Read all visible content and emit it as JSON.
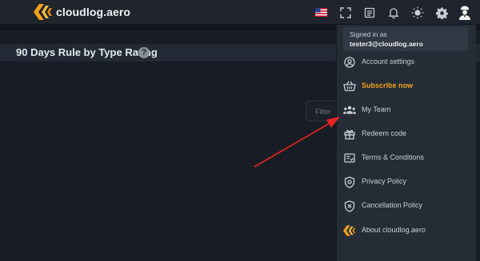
{
  "app": {
    "brand_name": "cloudlog.aero",
    "brand_color": "#f0a31d"
  },
  "topbar": {
    "icons": [
      "us-flag-icon",
      "expand-icon",
      "logbook-icon",
      "bell-icon",
      "brightness-icon",
      "gear-icon",
      "user-avatar-icon"
    ]
  },
  "page": {
    "title": "90 Days Rule by Type Rating",
    "help_symbol": "?",
    "filter_placeholder": "Filter"
  },
  "dropdown": {
    "signed_in_label": "Signed in as",
    "username": "tester3@cloudlog.aero",
    "items": [
      {
        "label": "Account settings",
        "icon": "account-icon"
      },
      {
        "label": "Subscribe now",
        "icon": "basket-icon",
        "accent": true
      },
      {
        "label": "My Team",
        "icon": "team-icon"
      },
      {
        "label": "Redeem code",
        "icon": "gift-icon"
      },
      {
        "label": "Terms & Conditions",
        "icon": "terms-icon"
      },
      {
        "label": "Privacy Policy",
        "icon": "privacy-shield-icon"
      },
      {
        "label": "Cancellation Policy",
        "icon": "cancel-shield-icon"
      },
      {
        "label": "About cloudlog.aero",
        "icon": "cloudlog-logo-icon"
      }
    ]
  },
  "annotation": {
    "arrow_color": "#e52421",
    "points_to": "My Team"
  }
}
